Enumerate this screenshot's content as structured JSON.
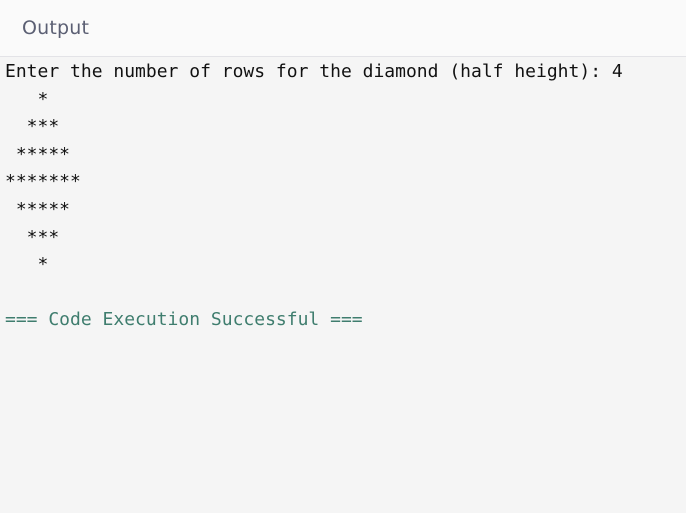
{
  "header": {
    "title": "Output"
  },
  "console": {
    "prompt_line": "Enter the number of rows for the diamond (half height): 4",
    "diamond_rows": [
      "   *",
      "  ***",
      " *****",
      "*******",
      " *****",
      "  ***",
      "   *"
    ],
    "status_line": "=== Code Execution Successful ==="
  },
  "colors": {
    "background": "#f5f5f5",
    "header_text": "#5b5f73",
    "console_text": "#111111",
    "status_text": "#3f7d6e"
  }
}
